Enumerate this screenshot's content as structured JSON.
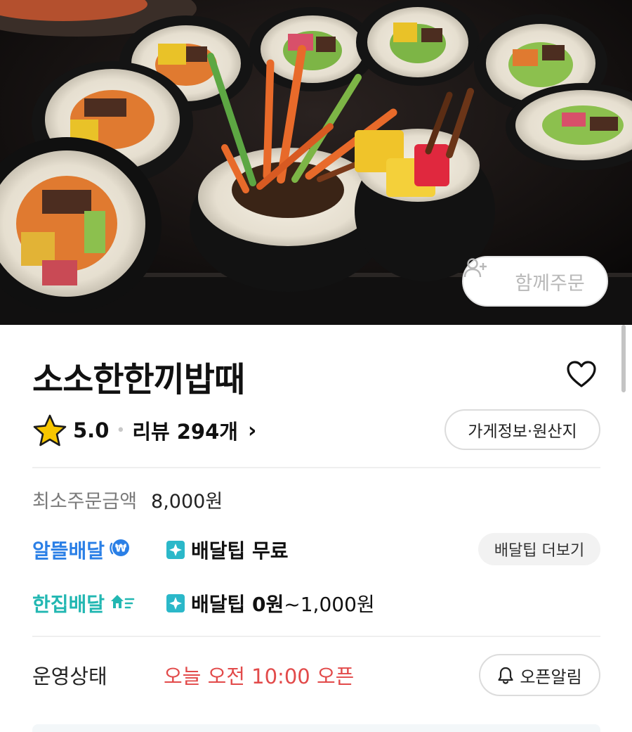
{
  "hero": {
    "group_order_label": "함께주문",
    "group_order_icon": "add-person-icon"
  },
  "store": {
    "name": "소소한한끼밥때",
    "favorite_icon": "heart-outline-icon"
  },
  "rating": {
    "star_icon": "star-icon",
    "value": "5.0",
    "separator": "•",
    "review_label": "리뷰",
    "review_count": "294개",
    "chevron": "›"
  },
  "info_button_label": "가게정보·원산지",
  "min_order": {
    "label": "최소주문금액",
    "value": "8,000원"
  },
  "delivery": {
    "saver": {
      "brand": "알뜰배달",
      "badge_icon": "won-coin-icon",
      "tip_bold": "배달팁 무료",
      "tip_rest": ""
    },
    "single": {
      "brand": "한집배달",
      "badge_icon": "speed-house-icon",
      "tip_bold": "배달팁 0원",
      "tip_rest": "~1,000원"
    },
    "tip_more_label": "배달팁 더보기"
  },
  "status": {
    "label": "운영상태",
    "value": "오늘 오전 10:00 오픈",
    "notify_label": "오픈알림",
    "notify_icon": "bell-icon"
  },
  "colors": {
    "saver_blue": "#2a7fe6",
    "single_teal": "#22b7b2",
    "status_red": "#e24a4a",
    "star_yellow": "#f7c600"
  }
}
